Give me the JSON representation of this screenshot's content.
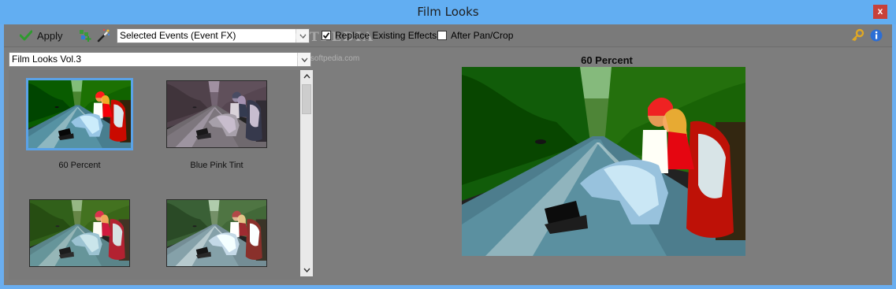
{
  "window": {
    "title": "Film Looks",
    "close_label": "x"
  },
  "toolbar": {
    "apply_label": "Apply",
    "target_combo_value": "Selected Events (Event FX)",
    "replace_effects_label": "Replace Existing Effects",
    "replace_effects_checked": true,
    "pan_crop_label": "After Pan/Crop",
    "pan_crop_checked": false,
    "icons": [
      "green-check-icon",
      "add-fx-icon",
      "magic-wand-icon",
      "key-icon",
      "info-icon"
    ]
  },
  "watermark": {
    "text": "SOFTPEDIA",
    "url_text": "www.softpedia.com"
  },
  "library": {
    "selected_pack": "Film Looks Vol.3",
    "presets": [
      {
        "label": "60 Percent",
        "selected": true,
        "tone": "vivid"
      },
      {
        "label": "Blue Pink Tint",
        "selected": false,
        "tone": "pinktint"
      },
      {
        "label": "",
        "selected": false,
        "tone": "cool"
      },
      {
        "label": "",
        "selected": false,
        "tone": "faded"
      }
    ]
  },
  "preview": {
    "title": "60 Percent"
  },
  "colors": {
    "titlebar": "#62aef2",
    "panel": "#7d7d7d",
    "selection": "#5aa2e8",
    "close": "#c8413a"
  }
}
